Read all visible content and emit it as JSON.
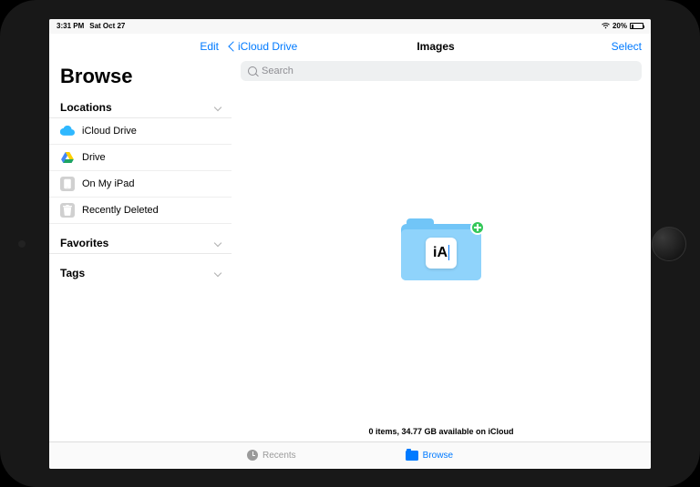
{
  "statusbar": {
    "time": "3:31 PM",
    "date": "Sat Oct 27",
    "battery_pct": "20%"
  },
  "nav": {
    "edit": "Edit",
    "back": "iCloud Drive",
    "title": "Images",
    "select": "Select"
  },
  "sidebar": {
    "heading": "Browse",
    "sections": {
      "locations": "Locations",
      "favorites": "Favorites",
      "tags": "Tags"
    },
    "items": [
      {
        "label": "iCloud Drive"
      },
      {
        "label": "Drive"
      },
      {
        "label": "On My iPad"
      },
      {
        "label": "Recently Deleted"
      }
    ]
  },
  "search": {
    "placeholder": "Search"
  },
  "folder": {
    "app_badge": "iA"
  },
  "footer": {
    "status": "0 items, 34.77 GB available on iCloud"
  },
  "tabs": {
    "recents": "Recents",
    "browse": "Browse"
  }
}
